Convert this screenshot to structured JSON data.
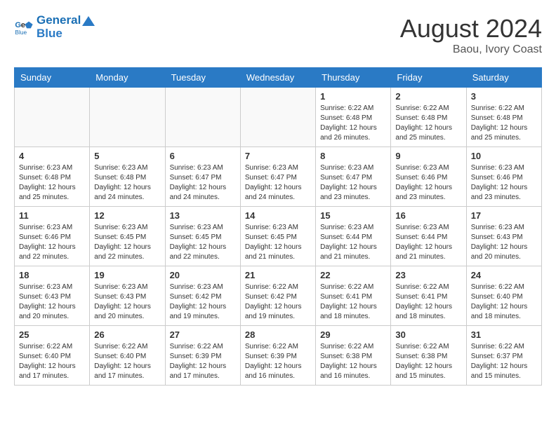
{
  "logo": {
    "text1": "General",
    "text2": "Blue"
  },
  "title": "August 2024",
  "subtitle": "Baou, Ivory Coast",
  "days_of_week": [
    "Sunday",
    "Monday",
    "Tuesday",
    "Wednesday",
    "Thursday",
    "Friday",
    "Saturday"
  ],
  "weeks": [
    [
      {
        "day": "",
        "info": ""
      },
      {
        "day": "",
        "info": ""
      },
      {
        "day": "",
        "info": ""
      },
      {
        "day": "",
        "info": ""
      },
      {
        "day": "1",
        "info": "Sunrise: 6:22 AM\nSunset: 6:48 PM\nDaylight: 12 hours and 26 minutes."
      },
      {
        "day": "2",
        "info": "Sunrise: 6:22 AM\nSunset: 6:48 PM\nDaylight: 12 hours and 25 minutes."
      },
      {
        "day": "3",
        "info": "Sunrise: 6:22 AM\nSunset: 6:48 PM\nDaylight: 12 hours and 25 minutes."
      }
    ],
    [
      {
        "day": "4",
        "info": "Sunrise: 6:23 AM\nSunset: 6:48 PM\nDaylight: 12 hours and 25 minutes."
      },
      {
        "day": "5",
        "info": "Sunrise: 6:23 AM\nSunset: 6:48 PM\nDaylight: 12 hours and 24 minutes."
      },
      {
        "day": "6",
        "info": "Sunrise: 6:23 AM\nSunset: 6:47 PM\nDaylight: 12 hours and 24 minutes."
      },
      {
        "day": "7",
        "info": "Sunrise: 6:23 AM\nSunset: 6:47 PM\nDaylight: 12 hours and 24 minutes."
      },
      {
        "day": "8",
        "info": "Sunrise: 6:23 AM\nSunset: 6:47 PM\nDaylight: 12 hours and 23 minutes."
      },
      {
        "day": "9",
        "info": "Sunrise: 6:23 AM\nSunset: 6:46 PM\nDaylight: 12 hours and 23 minutes."
      },
      {
        "day": "10",
        "info": "Sunrise: 6:23 AM\nSunset: 6:46 PM\nDaylight: 12 hours and 23 minutes."
      }
    ],
    [
      {
        "day": "11",
        "info": "Sunrise: 6:23 AM\nSunset: 6:46 PM\nDaylight: 12 hours and 22 minutes."
      },
      {
        "day": "12",
        "info": "Sunrise: 6:23 AM\nSunset: 6:45 PM\nDaylight: 12 hours and 22 minutes."
      },
      {
        "day": "13",
        "info": "Sunrise: 6:23 AM\nSunset: 6:45 PM\nDaylight: 12 hours and 22 minutes."
      },
      {
        "day": "14",
        "info": "Sunrise: 6:23 AM\nSunset: 6:45 PM\nDaylight: 12 hours and 21 minutes."
      },
      {
        "day": "15",
        "info": "Sunrise: 6:23 AM\nSunset: 6:44 PM\nDaylight: 12 hours and 21 minutes."
      },
      {
        "day": "16",
        "info": "Sunrise: 6:23 AM\nSunset: 6:44 PM\nDaylight: 12 hours and 21 minutes."
      },
      {
        "day": "17",
        "info": "Sunrise: 6:23 AM\nSunset: 6:43 PM\nDaylight: 12 hours and 20 minutes."
      }
    ],
    [
      {
        "day": "18",
        "info": "Sunrise: 6:23 AM\nSunset: 6:43 PM\nDaylight: 12 hours and 20 minutes."
      },
      {
        "day": "19",
        "info": "Sunrise: 6:23 AM\nSunset: 6:43 PM\nDaylight: 12 hours and 20 minutes."
      },
      {
        "day": "20",
        "info": "Sunrise: 6:23 AM\nSunset: 6:42 PM\nDaylight: 12 hours and 19 minutes."
      },
      {
        "day": "21",
        "info": "Sunrise: 6:22 AM\nSunset: 6:42 PM\nDaylight: 12 hours and 19 minutes."
      },
      {
        "day": "22",
        "info": "Sunrise: 6:22 AM\nSunset: 6:41 PM\nDaylight: 12 hours and 18 minutes."
      },
      {
        "day": "23",
        "info": "Sunrise: 6:22 AM\nSunset: 6:41 PM\nDaylight: 12 hours and 18 minutes."
      },
      {
        "day": "24",
        "info": "Sunrise: 6:22 AM\nSunset: 6:40 PM\nDaylight: 12 hours and 18 minutes."
      }
    ],
    [
      {
        "day": "25",
        "info": "Sunrise: 6:22 AM\nSunset: 6:40 PM\nDaylight: 12 hours and 17 minutes."
      },
      {
        "day": "26",
        "info": "Sunrise: 6:22 AM\nSunset: 6:40 PM\nDaylight: 12 hours and 17 minutes."
      },
      {
        "day": "27",
        "info": "Sunrise: 6:22 AM\nSunset: 6:39 PM\nDaylight: 12 hours and 17 minutes."
      },
      {
        "day": "28",
        "info": "Sunrise: 6:22 AM\nSunset: 6:39 PM\nDaylight: 12 hours and 16 minutes."
      },
      {
        "day": "29",
        "info": "Sunrise: 6:22 AM\nSunset: 6:38 PM\nDaylight: 12 hours and 16 minutes."
      },
      {
        "day": "30",
        "info": "Sunrise: 6:22 AM\nSunset: 6:38 PM\nDaylight: 12 hours and 15 minutes."
      },
      {
        "day": "31",
        "info": "Sunrise: 6:22 AM\nSunset: 6:37 PM\nDaylight: 12 hours and 15 minutes."
      }
    ]
  ]
}
